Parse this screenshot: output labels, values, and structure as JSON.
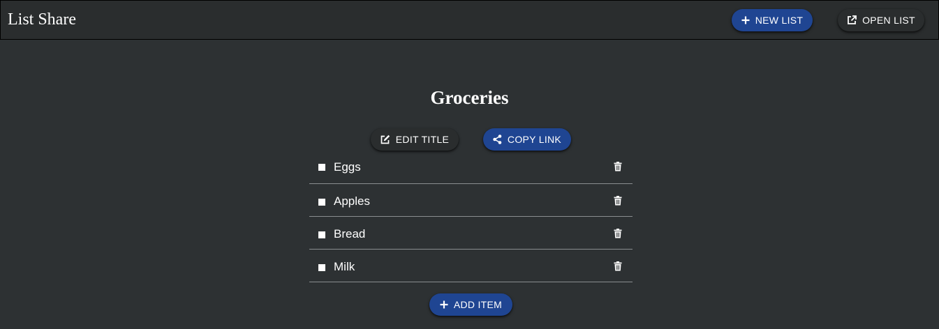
{
  "app": {
    "title": "List Share"
  },
  "header": {
    "new_list_label": "NEW LIST",
    "open_list_label": "OPEN LIST"
  },
  "list": {
    "title": "Groceries",
    "edit_title_label": "EDIT TITLE",
    "copy_link_label": "COPY LINK",
    "items": [
      {
        "label": "Eggs",
        "checked": false
      },
      {
        "label": "Apples",
        "checked": false
      },
      {
        "label": "Bread",
        "checked": false
      },
      {
        "label": "Milk",
        "checked": false
      }
    ],
    "add_item_label": "ADD ITEM"
  },
  "icons": {
    "new_list": "plus-icon",
    "open_list": "external-link-icon",
    "edit_title": "edit-icon",
    "copy_link": "share-icon",
    "delete_item": "trash-icon",
    "add_item": "plus-icon"
  },
  "colors": {
    "background": "#2d3133",
    "appbar": "#2a2d2e",
    "primary_button": "#1f4592",
    "dark_button": "#2a2d2e",
    "divider": "#8a8e90",
    "text": "#ffffff"
  }
}
